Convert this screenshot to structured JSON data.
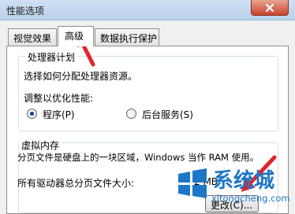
{
  "window": {
    "title": "性能选项"
  },
  "tabs": [
    {
      "label": "视觉效果"
    },
    {
      "label": "高级"
    },
    {
      "label": "数据执行保护"
    }
  ],
  "processor": {
    "group_title": "处理器计划",
    "description": "选择如何分配处理器资源。",
    "optimize_label": "调整以优化性能:",
    "options": [
      {
        "label": "程序(P)",
        "checked": true
      },
      {
        "label": "后台服务(S)",
        "checked": false
      }
    ]
  },
  "virtual_memory": {
    "group_title": "虚拟内存",
    "description": "分页文件是硬盘上的一块区域，Windows 当作 RAM 使用。",
    "total_label": "所有驱动器总分页文件大小:",
    "total_value": "2 MB",
    "change_button": "更改(C)..."
  },
  "watermark": {
    "brand": "系统城",
    "url": "xitongcheng.com"
  },
  "colors": {
    "annotation_arrow": "#e0262a",
    "watermark": "#1e76c7"
  }
}
